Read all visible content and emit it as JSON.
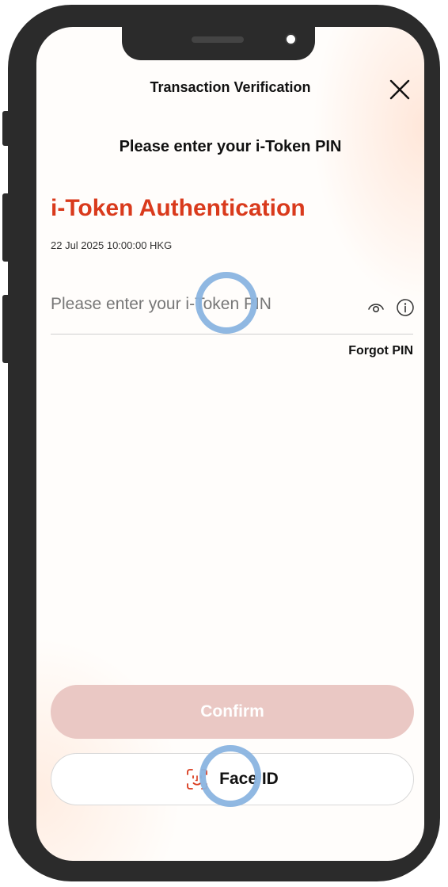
{
  "header": {
    "title": "Transaction Verification"
  },
  "prompt": "Please enter your i-Token PIN",
  "auth": {
    "heading": "i-Token Authentication",
    "timestamp": "22 Jul 2025 10:00:00 HKG"
  },
  "pin_field": {
    "placeholder": "Please enter your i-Token PIN",
    "value": ""
  },
  "links": {
    "forgot_pin": "Forgot PIN"
  },
  "buttons": {
    "confirm_label": "Confirm",
    "faceid_label": "Face ID"
  },
  "icons": {
    "close": "close-icon",
    "eye": "eye-icon",
    "info": "info-icon",
    "faceid": "face-id-icon"
  },
  "colors": {
    "accent": "#d93a1c",
    "confirm_disabled": "#eac8c4",
    "tap_indicator": "#8ab4e0"
  }
}
